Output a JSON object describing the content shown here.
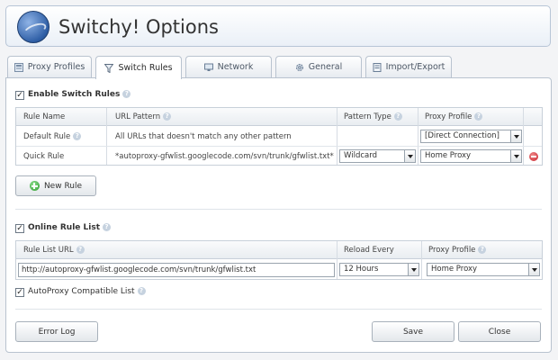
{
  "app": {
    "title": "Switchy! Options"
  },
  "tabs": [
    {
      "label": "Proxy Profiles",
      "icon": "proxy-profiles-icon"
    },
    {
      "label": "Switch Rules",
      "icon": "funnel-icon",
      "active": true
    },
    {
      "label": "Network",
      "icon": "network-icon"
    },
    {
      "label": "General",
      "icon": "gear-icon"
    },
    {
      "label": "Import/Export",
      "icon": "import-export-icon"
    }
  ],
  "switch_rules": {
    "enable_label": "Enable Switch Rules",
    "enabled": true,
    "columns": [
      "Rule Name",
      "URL Pattern",
      "Pattern Type",
      "Proxy Profile"
    ],
    "rows": [
      {
        "name": "Default Rule",
        "pattern": "All URLs that doesn't match any other pattern",
        "type": "",
        "profile": "[Direct Connection]"
      },
      {
        "name": "Quick Rule",
        "pattern": "*autoproxy-gfwlist.googlecode.com/svn/trunk/gfwlist.txt*",
        "type": "Wildcard",
        "profile": "Home Proxy"
      }
    ],
    "new_rule_label": "New Rule"
  },
  "online_rule_list": {
    "label": "Online Rule List",
    "enabled": true,
    "columns": [
      "Rule List URL",
      "Reload Every",
      "Proxy Profile"
    ],
    "url": "http://autoproxy-gfwlist.googlecode.com/svn/trunk/gfwlist.txt",
    "reload": "12  Hours",
    "profile": "Home Proxy",
    "autoproxy_label": "AutoProxy Compatible List",
    "autoproxy_enabled": true
  },
  "footer": {
    "error_log_label": "Error Log",
    "save_label": "Save",
    "close_label": "Close"
  },
  "check_mark": "✓",
  "help_glyph": "?"
}
